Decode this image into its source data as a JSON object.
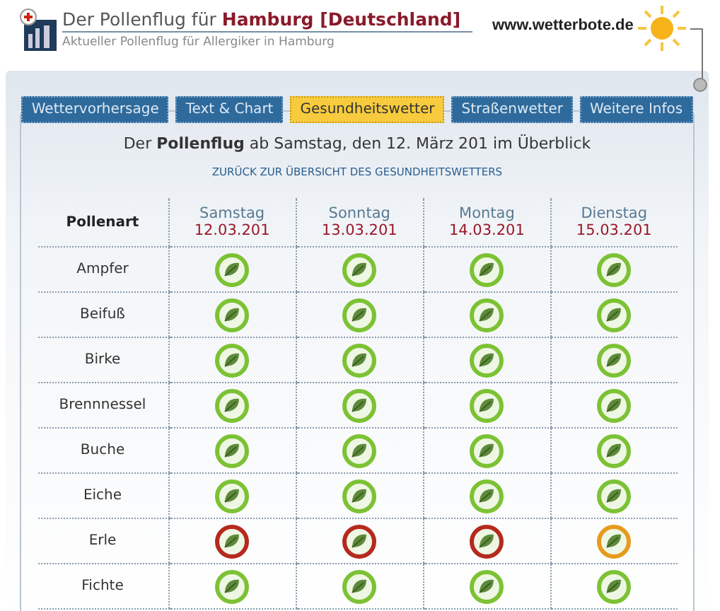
{
  "header": {
    "title": "Der Pollenflug für **Hamburg [Deutschland]**",
    "subtitle": "Aktueller Pollenflug für Allergiker in Hamburg",
    "site": "www.wetterbote.de"
  },
  "tabs": [
    {
      "label": "Wettervorhersage",
      "selected": false
    },
    {
      "label": "Text & Chart",
      "selected": false
    },
    {
      "label": "Gesundheitswetter",
      "selected": true
    },
    {
      "label": "Straßenwetter",
      "selected": false
    },
    {
      "label": "Weitere Infos",
      "selected": false
    }
  ],
  "intro": "Der **Pollenflug** ab Samstag, den 12. März 201 im Überblick",
  "back_link": "ZURÜCK ZUR ÜBERSICHT DES GESUNDHEITSWETTERS",
  "table": {
    "corner": "Pollenart",
    "columns": [
      {
        "day": "Samstag",
        "date": "12.03.201"
      },
      {
        "day": "Sonntag",
        "date": "13.03.201"
      },
      {
        "day": "Montag",
        "date": "14.03.201"
      },
      {
        "day": "Dienstag",
        "date": "15.03.201"
      }
    ],
    "rows": [
      {
        "name": "Ampfer",
        "cells": [
          {
            "color": "#7cc234"
          },
          {
            "color": "#7cc234"
          },
          {
            "color": "#7cc234"
          },
          {
            "color": "#7cc234"
          }
        ]
      },
      {
        "name": "Beifuß",
        "cells": [
          {
            "color": "#7cc234"
          },
          {
            "color": "#7cc234"
          },
          {
            "color": "#7cc234"
          },
          {
            "color": "#7cc234"
          }
        ]
      },
      {
        "name": "Birke",
        "cells": [
          {
            "color": "#7cc234"
          },
          {
            "color": "#7cc234"
          },
          {
            "color": "#7cc234"
          },
          {
            "color": "#7cc234"
          }
        ]
      },
      {
        "name": "Brennnessel",
        "cells": [
          {
            "color": "#7cc234"
          },
          {
            "color": "#7cc234"
          },
          {
            "color": "#7cc234"
          },
          {
            "color": "#7cc234"
          }
        ]
      },
      {
        "name": "Buche",
        "cells": [
          {
            "color": "#7cc234"
          },
          {
            "color": "#7cc234"
          },
          {
            "color": "#7cc234"
          },
          {
            "color": "#7cc234"
          }
        ]
      },
      {
        "name": "Eiche",
        "cells": [
          {
            "color": "#7cc234"
          },
          {
            "color": "#7cc234"
          },
          {
            "color": "#7cc234"
          },
          {
            "color": "#7cc234"
          }
        ]
      },
      {
        "name": "Erle",
        "cells": [
          {
            "color": "#b52a1e"
          },
          {
            "color": "#b52a1e"
          },
          {
            "color": "#b52a1e"
          },
          {
            "color": "#e89a1c"
          }
        ]
      },
      {
        "name": "Fichte",
        "cells": [
          {
            "color": "#7cc234"
          },
          {
            "color": "#7cc234"
          },
          {
            "color": "#7cc234"
          },
          {
            "color": "#7cc234"
          }
        ]
      }
    ]
  }
}
